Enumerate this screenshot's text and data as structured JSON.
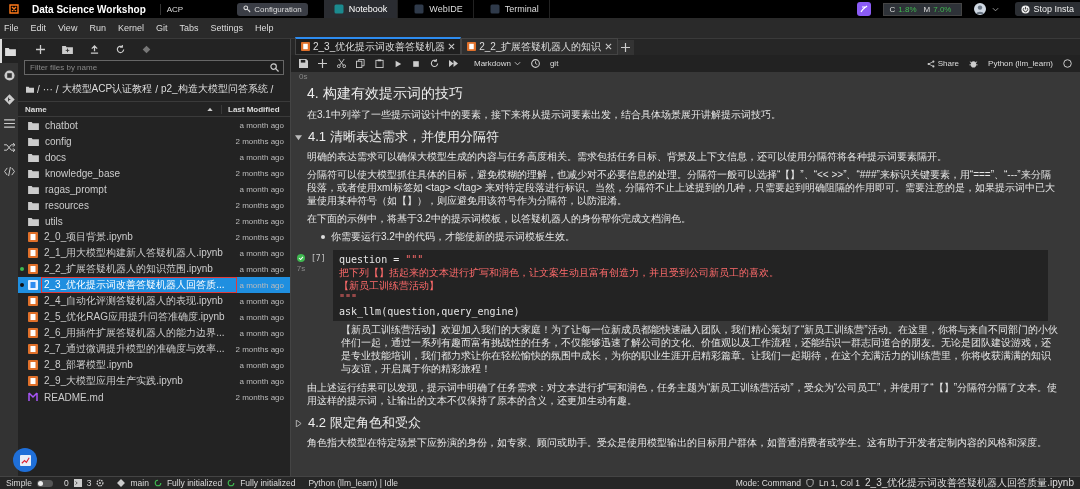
{
  "top_bar": {
    "app_title": "Data Science Workshop",
    "workspace": "ACP",
    "config_button": "Configuration",
    "tabs": [
      {
        "label": "Notebook",
        "selected": true
      },
      {
        "label": "WebIDE",
        "selected": false
      },
      {
        "label": "Terminal",
        "selected": false
      }
    ],
    "usage": {
      "cpu_label": "C",
      "cpu": "1.8%",
      "mem_label": "M",
      "mem": "7.0%"
    },
    "stop_button": "Stop Insta"
  },
  "menu": [
    "File",
    "Edit",
    "View",
    "Run",
    "Kernel",
    "Git",
    "Tabs",
    "Settings",
    "Help"
  ],
  "activity_bar": [
    {
      "kind": "folder",
      "selected": true
    },
    {
      "kind": "stop",
      "selected": false
    },
    {
      "kind": "git",
      "selected": false
    },
    {
      "kind": "list",
      "selected": false
    },
    {
      "kind": "shuffle",
      "selected": false
    },
    {
      "kind": "code",
      "selected": false
    }
  ],
  "file_browser": {
    "filter_placeholder": "Filter files by name",
    "path_separator": "/",
    "breadcrumb": [
      "···",
      "大模型ACP认证教程",
      "p2_构造大模型问答系统"
    ],
    "columns": [
      "Name",
      "Last Modified"
    ],
    "files": [
      {
        "kind": "folder",
        "name": "chatbot",
        "modified": "a month ago",
        "running": false,
        "selected": false
      },
      {
        "kind": "folder",
        "name": "config",
        "modified": "2 months ago",
        "running": false,
        "selected": false
      },
      {
        "kind": "folder",
        "name": "docs",
        "modified": "a month ago",
        "running": false,
        "selected": false
      },
      {
        "kind": "folder",
        "name": "knowledge_base",
        "modified": "2 months ago",
        "running": false,
        "selected": false
      },
      {
        "kind": "folder",
        "name": "ragas_prompt",
        "modified": "a month ago",
        "running": false,
        "selected": false
      },
      {
        "kind": "folder",
        "name": "resources",
        "modified": "2 months ago",
        "running": false,
        "selected": false
      },
      {
        "kind": "folder",
        "name": "utils",
        "modified": "2 months ago",
        "running": false,
        "selected": false
      },
      {
        "kind": "notebook",
        "name": "2_0_项目背景.ipynb",
        "modified": "2 months ago",
        "running": false,
        "selected": false
      },
      {
        "kind": "notebook",
        "name": "2_1_用大模型构建新人答疑机器人.ipynb",
        "modified": "a month ago",
        "running": false,
        "selected": false
      },
      {
        "kind": "notebook",
        "name": "2_2_扩展答疑机器人的知识范围.ipynb",
        "modified": "a month ago",
        "running": true,
        "selected": false
      },
      {
        "kind": "notebook",
        "name": "2_3_优化提示词改善答疑机器人回答质...",
        "modified": "a month ago",
        "running": true,
        "selected": true
      },
      {
        "kind": "notebook",
        "name": "2_4_自动化评测答疑机器人的表现.ipynb",
        "modified": "a month ago",
        "running": false,
        "selected": false
      },
      {
        "kind": "notebook",
        "name": "2_5_优化RAG应用提升问答准确度.ipynb",
        "modified": "a month ago",
        "running": false,
        "selected": false
      },
      {
        "kind": "notebook",
        "name": "2_6_用插件扩展答疑机器人的能力边界...",
        "modified": "a month ago",
        "running": false,
        "selected": false
      },
      {
        "kind": "notebook",
        "name": "2_7_通过微调提升模型的准确度与效率...",
        "modified": "2 months ago",
        "running": false,
        "selected": false
      },
      {
        "kind": "notebook",
        "name": "2_8_部署模型.ipynb",
        "modified": "a month ago",
        "running": false,
        "selected": false
      },
      {
        "kind": "notebook",
        "name": "2_9_大模型应用生产实践.ipynb",
        "modified": "a month ago",
        "running": false,
        "selected": false
      },
      {
        "kind": "markdown",
        "name": "README.md",
        "modified": "2 months ago",
        "running": false,
        "selected": false
      }
    ]
  },
  "notebook": {
    "tabs": [
      {
        "label": "2_3_优化提示词改善答疑机器",
        "selected": true
      },
      {
        "label": "2_2_扩展答疑机器人的知识",
        "selected": false
      }
    ],
    "cell_type": "Markdown",
    "git_label": "git",
    "share": "Share",
    "kernel": "Python (llm_learn)",
    "exec_time": "0s",
    "cells": [
      {
        "kind": "h2",
        "text": "4. 构建有效提示词的技巧"
      },
      {
        "kind": "p",
        "text": "在3.1中列举了一些提示词设计中的要素，接下来将从提示词要素出发，结合具体场景展开讲解提示词技巧。"
      },
      {
        "kind": "h3",
        "text": "4.1 清晰表达需求，并使用分隔符",
        "expanded": true
      },
      {
        "kind": "p",
        "text": "明确的表达需求可以确保大模型生成的内容与任务高度相关。需求包括任务目标、背景及上下文信息，还可以使用分隔符将各种提示词要素隔开。"
      },
      {
        "kind": "p",
        "text": "分隔符可以使大模型抓住具体的目标，避免模糊的理解，也减少对不必要信息的处理。分隔符一般可以选择“【】”、“<< >>”、“###”来标识关键要素，用“===”、“---”来分隔段落，或者使用xml标签如 <tag> </tag> 来对特定段落进行标识。当然，分隔符不止上述提到的几种，只需要起到明确阻隔的作用即可。需要注意的是，如果提示词中已大量使用某种符号（如【】），则应避免用该符号作为分隔符，以防混淆。"
      },
      {
        "kind": "p",
        "text": "在下面的示例中，将基于3.2中的提示词模板，以答疑机器人的身份帮你完成文档润色。"
      },
      {
        "kind": "bullet",
        "text": "你需要运行3.2中的代码，才能使新的提示词模板生效。"
      },
      {
        "kind": "code",
        "prompt": "[7]",
        "time": "7s",
        "lines": [
          [
            {
              "kind": "name",
              "text": "question"
            },
            {
              "kind": "op",
              "text": "="
            },
            {
              "kind": "string",
              "text": "\"\"\""
            }
          ],
          [
            {
              "kind": "string",
              "text": "把下列【】括起来的文本进行扩写和润色，让文案生动且富有创造力，并且受到公司新员工的喜欢。"
            }
          ],
          [
            {
              "kind": "string",
              "text": "【新员工训练营活动】"
            }
          ],
          [
            {
              "kind": "string",
              "text": "\"\"\""
            }
          ],
          [
            {
              "kind": "name",
              "text": "ask_llm(question,query_engine)"
            }
          ]
        ]
      },
      {
        "kind": "output",
        "text": "【新员工训练营活动】欢迎加入我们的大家庭！为了让每一位新成员都能快速融入团队，我们精心策划了“新员工训练营”活动。在这里，你将与来自不同部门的小伙伴们一起，通过一系列有趣而富有挑战性的任务，不仅能够迅速了解公司的文化、价值观以及工作流程，还能结识一群志同道合的朋友。无论是团队建设游戏，还是专业技能培训，我们都力求让你在轻松愉快的氛围中成长，为你的职业生涯开启精彩篇章。让我们一起期待，在这个充满活力的训练营里，你将收获满满的知识与友谊，开启属于你的精彩旅程！"
      },
      {
        "kind": "p",
        "text": "由上述运行结果可以发现，提示词中明确了任务需求：对文本进行扩写和润色，任务主题为“新员工训练营活动”，受众为“公司员工”，并使用了“【】”分隔符分隔了文本。使用这样的提示词，让输出的文本不仅保持了原本的含义，还更加生动有趣。"
      },
      {
        "kind": "h3",
        "text": "4.2 限定角色和受众",
        "expanded": false
      },
      {
        "kind": "p",
        "text": "角色指大模型在特定场景下应扮演的身份，如专家、顾问或助手。受众是使用模型输出的目标用户群体，如普通消费者或学生。这有助于开发者定制内容的风格和深度。"
      }
    ]
  },
  "status_bar": {
    "mode_label": "Simple",
    "simple_mode": false,
    "terminals": "0",
    "kernels": "3",
    "branch": "main",
    "git_status": "Fully initialized",
    "lsp_status": "Fully initialized",
    "kernel_status": "Python (llm_learn) | Idle",
    "mode": "Mode: Command",
    "position": "Ln 1, Col 1",
    "file": "2_3_优化提示词改善答疑机器人回答质量.ipynb"
  }
}
